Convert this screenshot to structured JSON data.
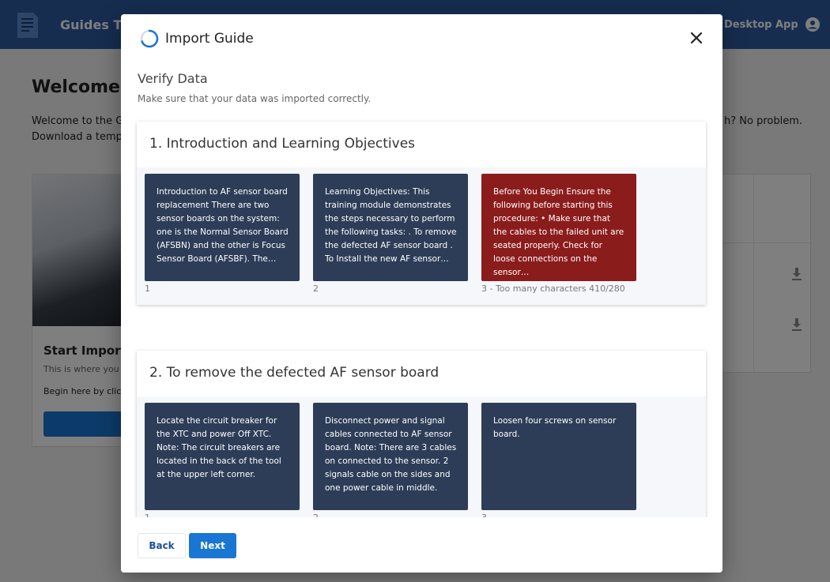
{
  "app": {
    "title": "Guides Tool",
    "desktop_app_label": "Desktop App",
    "welcome_title": "Welcome",
    "welcome_line1": "Welcome to the Guides Tool.",
    "welcome_line2": "Download a template",
    "welcome_right": "h? No problem.",
    "start_import_title": "Start Import",
    "start_import_sub": "This is where you",
    "start_import_begin": "Begin here by clicking"
  },
  "dialog": {
    "title": "Import Guide",
    "step_title": "Verify Data",
    "step_subtitle": "Make sure that your data was imported correctly.",
    "sections": [
      {
        "title": "1. Introduction and Learning Objectives",
        "steps": [
          {
            "text": "Introduction to AF sensor board replacement There are two sensor boards on the system: one is the Normal Sensor Board (AFSBN) and the other is Focus Sensor Board (AFSBF). The…",
            "label": "1",
            "error": false
          },
          {
            "text": "Learning Objectives: This training module demonstrates the steps necessary to perform the following tasks: . To remove the defected AF sensor board . To Install the new AF sensor…",
            "label": "2",
            "error": false
          },
          {
            "text": "Before You Begin Ensure the following before starting this procedure: • Make sure that the cables to the failed unit are seated properly. Check for loose connections on the sensor…",
            "label": "3 - Too many characters 410/280",
            "error": true
          }
        ]
      },
      {
        "title": "2. To remove the defected AF sensor board",
        "steps": [
          {
            "text": "Locate the circuit breaker for the XTC and power Off XTC. Note: The circuit breakers are located in the back of the tool at the upper left corner.",
            "label": "1",
            "error": false
          },
          {
            "text": "Disconnect power and signal cables connected to AF sensor board. Note: There are 3 cables on connected to the sensor. 2 signals cable on the sides and one power cable in middle.",
            "label": "2",
            "error": false
          },
          {
            "text": "Loosen four screws on sensor board.",
            "label": "3",
            "error": false
          }
        ]
      }
    ],
    "back_label": "Back",
    "next_label": "Next"
  },
  "colors": {
    "topbar": "#2c5aa0",
    "primary": "#1976d2",
    "step_card": "#2d3d57",
    "step_error": "#8b1c1c"
  },
  "icons": [
    "app-logo-icon",
    "user-icon",
    "spinner-icon",
    "close-icon",
    "download-icon"
  ]
}
